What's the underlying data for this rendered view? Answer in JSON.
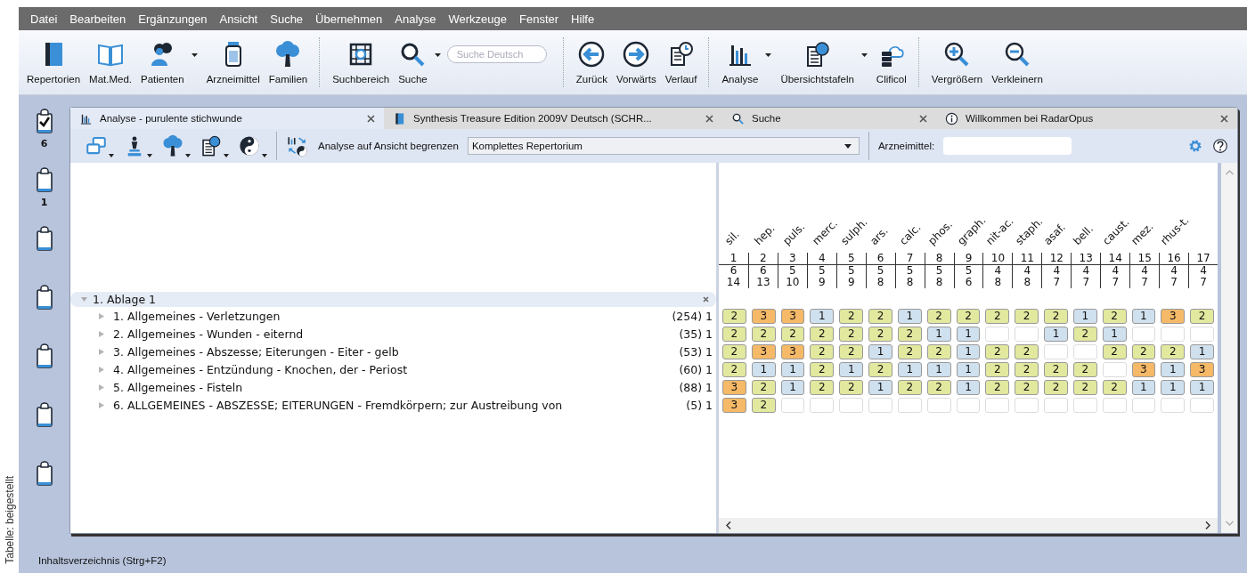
{
  "credit": "Tabelle: beigestellt",
  "menu": [
    "Datei",
    "Bearbeiten",
    "Ergänzungen",
    "Ansicht",
    "Suche",
    "Übernehmen",
    "Analyse",
    "Werkzeuge",
    "Fenster",
    "Hilfe"
  ],
  "toolbar": {
    "groups": [
      {
        "items": [
          {
            "label": "Repertorien",
            "kind": "book",
            "dropdown": false
          },
          {
            "label": "Mat.Med.",
            "kind": "openbook",
            "dropdown": false
          },
          {
            "label": "Patienten",
            "kind": "people",
            "dropdown": true
          },
          {
            "label": "Arzneimittel",
            "kind": "jar",
            "dropdown": false
          },
          {
            "label": "Familien",
            "kind": "tree",
            "dropdown": false
          }
        ]
      },
      {
        "items": [
          {
            "label": "Suchbereich",
            "kind": "target",
            "dropdown": false
          },
          {
            "label": "Suche",
            "kind": "search",
            "dropdown": true
          }
        ],
        "search": {
          "placeholder": "Suche Deutsch"
        }
      },
      {
        "items": [
          {
            "label": "Zurück",
            "kind": "back",
            "dropdown": false
          },
          {
            "label": "Vorwärts",
            "kind": "forward",
            "dropdown": false
          },
          {
            "label": "Verlauf",
            "kind": "history",
            "dropdown": false
          }
        ]
      },
      {
        "items": [
          {
            "label": "Analyse",
            "kind": "chart",
            "dropdown": true
          },
          {
            "label": "Übersichtstafeln",
            "kind": "tables",
            "dropdown": true
          },
          {
            "label": "Clificol",
            "kind": "cloud",
            "dropdown": false
          }
        ]
      },
      {
        "items": [
          {
            "label": "Vergrößern",
            "kind": "zoomin",
            "dropdown": false
          },
          {
            "label": "Verkleinern",
            "kind": "zoomout",
            "dropdown": false
          }
        ]
      }
    ]
  },
  "clipboards": [
    {
      "checked": true,
      "count": "6"
    },
    {
      "checked": false,
      "count": "1"
    },
    {
      "checked": false
    },
    {
      "checked": false
    },
    {
      "checked": false
    },
    {
      "checked": false
    },
    {
      "checked": false
    }
  ],
  "tabs": [
    {
      "label": "Analyse - purulente stichwunde",
      "kind": "chart",
      "selected": true
    },
    {
      "label": "Synthesis Treasure Edition 2009V Deutsch (SCHR...",
      "kind": "book",
      "selected": false
    },
    {
      "label": "Suche",
      "kind": "search",
      "selected": false
    },
    {
      "label": "Willkommen bei RadarOpus",
      "kind": "info",
      "selected": false
    }
  ],
  "analysis_toolbar": {
    "tools": [
      {
        "kind": "windows",
        "dropdown": true
      },
      {
        "kind": "chess",
        "dropdown": true
      },
      {
        "kind": "tree",
        "dropdown": true
      },
      {
        "kind": "tables",
        "dropdown": true
      },
      {
        "kind": "yinyang",
        "dropdown": true
      }
    ],
    "limit_label": "Analyse auf Ansicht begrenzen",
    "limit_value": "Komplettes Repertorium",
    "remedy_label": "Arzneimittel:"
  },
  "tree": {
    "label": "1. Ablage 1",
    "expanded": true,
    "children": [
      {
        "label": "1. Allgemeines - Verletzungen",
        "count": "(254) 1",
        "expanded": false
      },
      {
        "label": "2. Allgemeines - Wunden - eiternd",
        "count": "(35) 1",
        "expanded": false
      },
      {
        "label": "3. Allgemeines - Abszesse; Eiterungen - Eiter - gelb",
        "count": "(53) 1",
        "expanded": false
      },
      {
        "label": "4. Allgemeines - Entzündung - Knochen, der - Periost",
        "count": "(60) 1",
        "expanded": false
      },
      {
        "label": "5. Allgemeines - Fisteln",
        "count": "(88) 1",
        "expanded": false
      },
      {
        "label": "6. ALLGEMEINES - ABSZESSE; EITERUNGEN - Fremdkörpern; zur Austreibung von",
        "count": "(5) 1",
        "expanded": false
      }
    ]
  },
  "remedies": [
    {
      "name": "sil.",
      "number": "1",
      "count": "6",
      "total": "14"
    },
    {
      "name": "hep.",
      "number": "2",
      "count": "6",
      "total": "13"
    },
    {
      "name": "puls.",
      "number": "3",
      "count": "5",
      "total": "10"
    },
    {
      "name": "merc.",
      "number": "4",
      "count": "5",
      "total": "9"
    },
    {
      "name": "sulph.",
      "number": "5",
      "count": "5",
      "total": "9"
    },
    {
      "name": "ars.",
      "number": "6",
      "count": "5",
      "total": "8"
    },
    {
      "name": "calc.",
      "number": "7",
      "count": "5",
      "total": "8"
    },
    {
      "name": "phos.",
      "number": "8",
      "count": "5",
      "total": "8"
    },
    {
      "name": "graph.",
      "number": "9",
      "count": "5",
      "total": "6"
    },
    {
      "name": "nit-ac.",
      "number": "10",
      "count": "4",
      "total": "8"
    },
    {
      "name": "staph.",
      "number": "11",
      "count": "4",
      "total": "8"
    },
    {
      "name": "asaf.",
      "number": "12",
      "count": "4",
      "total": "7"
    },
    {
      "name": "bell.",
      "number": "13",
      "count": "4",
      "total": "7"
    },
    {
      "name": "caust.",
      "number": "14",
      "count": "4",
      "total": "7"
    },
    {
      "name": "mez.",
      "number": "15",
      "count": "4",
      "total": "7"
    },
    {
      "name": "rhus-t.",
      "number": "16",
      "count": "4",
      "total": "7"
    },
    {
      "number": "17",
      "count": "4",
      "total": "7"
    }
  ],
  "grid": [
    [
      {
        "kind": "grade",
        "value": "2",
        "color": "#e2e89e"
      },
      {
        "kind": "grade",
        "value": "3",
        "color": "#f5b968"
      },
      {
        "kind": "grade",
        "value": "3",
        "color": "#f5b968"
      },
      {
        "kind": "grade",
        "value": "1",
        "color": "#cfe0ee"
      },
      {
        "kind": "grade",
        "value": "2",
        "color": "#e2e89e"
      },
      {
        "kind": "grade",
        "value": "2",
        "color": "#e2e89e"
      },
      {
        "kind": "grade",
        "value": "1",
        "color": "#cfe0ee"
      },
      {
        "kind": "grade",
        "value": "2",
        "color": "#e2e89e"
      },
      {
        "kind": "grade",
        "value": "2",
        "color": "#e2e89e"
      },
      {
        "kind": "grade",
        "value": "2",
        "color": "#e2e89e"
      },
      {
        "kind": "grade",
        "value": "2",
        "color": "#e2e89e"
      },
      {
        "kind": "grade",
        "value": "2",
        "color": "#e2e89e"
      },
      {
        "kind": "grade",
        "value": "1",
        "color": "#cfe0ee"
      },
      {
        "kind": "grade",
        "value": "2",
        "color": "#e2e89e"
      },
      {
        "kind": "grade",
        "value": "1",
        "color": "#cfe0ee"
      },
      {
        "kind": "grade",
        "value": "3",
        "color": "#f5b968"
      },
      {
        "kind": "grade",
        "value": "2",
        "color": "#e2e89e"
      }
    ],
    [
      {
        "kind": "grade",
        "value": "2",
        "color": "#e2e89e"
      },
      {
        "kind": "grade",
        "value": "2",
        "color": "#e2e89e"
      },
      {
        "kind": "grade",
        "value": "2",
        "color": "#e2e89e"
      },
      {
        "kind": "grade",
        "value": "2",
        "color": "#e2e89e"
      },
      {
        "kind": "grade",
        "value": "2",
        "color": "#e2e89e"
      },
      {
        "kind": "grade",
        "value": "2",
        "color": "#e2e89e"
      },
      {
        "kind": "grade",
        "value": "2",
        "color": "#e2e89e"
      },
      {
        "kind": "grade",
        "value": "1",
        "color": "#cfe0ee"
      },
      {
        "kind": "grade",
        "value": "1",
        "color": "#cfe0ee"
      },
      {
        "kind": "empty"
      },
      {
        "kind": "empty"
      },
      {
        "kind": "grade",
        "value": "1",
        "color": "#cfe0ee"
      },
      {
        "kind": "grade",
        "value": "2",
        "color": "#e2e89e"
      },
      {
        "kind": "grade",
        "value": "1",
        "color": "#cfe0ee"
      },
      {
        "kind": "empty"
      },
      {
        "kind": "empty"
      },
      {
        "kind": "empty"
      }
    ],
    [
      {
        "kind": "grade",
        "value": "2",
        "color": "#e2e89e"
      },
      {
        "kind": "grade",
        "value": "3",
        "color": "#f5b968"
      },
      {
        "kind": "grade",
        "value": "3",
        "color": "#f5b968"
      },
      {
        "kind": "grade",
        "value": "2",
        "color": "#e2e89e"
      },
      {
        "kind": "grade",
        "value": "2",
        "color": "#e2e89e"
      },
      {
        "kind": "grade",
        "value": "1",
        "color": "#cfe0ee"
      },
      {
        "kind": "grade",
        "value": "2",
        "color": "#e2e89e"
      },
      {
        "kind": "grade",
        "value": "2",
        "color": "#e2e89e"
      },
      {
        "kind": "grade",
        "value": "1",
        "color": "#cfe0ee"
      },
      {
        "kind": "grade",
        "value": "2",
        "color": "#e2e89e"
      },
      {
        "kind": "grade",
        "value": "2",
        "color": "#e2e89e"
      },
      {
        "kind": "empty"
      },
      {
        "kind": "empty"
      },
      {
        "kind": "grade",
        "value": "2",
        "color": "#e2e89e"
      },
      {
        "kind": "grade",
        "value": "2",
        "color": "#e2e89e"
      },
      {
        "kind": "grade",
        "value": "2",
        "color": "#e2e89e"
      },
      {
        "kind": "grade",
        "value": "1",
        "color": "#cfe0ee"
      }
    ],
    [
      {
        "kind": "grade",
        "value": "2",
        "color": "#e2e89e"
      },
      {
        "kind": "grade",
        "value": "1",
        "color": "#cfe0ee"
      },
      {
        "kind": "grade",
        "value": "1",
        "color": "#cfe0ee"
      },
      {
        "kind": "grade",
        "value": "2",
        "color": "#e2e89e"
      },
      {
        "kind": "grade",
        "value": "1",
        "color": "#cfe0ee"
      },
      {
        "kind": "grade",
        "value": "2",
        "color": "#e2e89e"
      },
      {
        "kind": "grade",
        "value": "1",
        "color": "#cfe0ee"
      },
      {
        "kind": "grade",
        "value": "1",
        "color": "#cfe0ee"
      },
      {
        "kind": "grade",
        "value": "1",
        "color": "#cfe0ee"
      },
      {
        "kind": "grade",
        "value": "2",
        "color": "#e2e89e"
      },
      {
        "kind": "grade",
        "value": "2",
        "color": "#e2e89e"
      },
      {
        "kind": "grade",
        "value": "2",
        "color": "#e2e89e"
      },
      {
        "kind": "grade",
        "value": "2",
        "color": "#e2e89e"
      },
      {
        "kind": "empty"
      },
      {
        "kind": "grade",
        "value": "3",
        "color": "#f5b968"
      },
      {
        "kind": "grade",
        "value": "1",
        "color": "#cfe0ee"
      },
      {
        "kind": "grade",
        "value": "3",
        "color": "#f5b968"
      }
    ],
    [
      {
        "kind": "grade",
        "value": "3",
        "color": "#f5b968"
      },
      {
        "kind": "grade",
        "value": "2",
        "color": "#e2e89e"
      },
      {
        "kind": "grade",
        "value": "1",
        "color": "#cfe0ee"
      },
      {
        "kind": "grade",
        "value": "2",
        "color": "#e2e89e"
      },
      {
        "kind": "grade",
        "value": "2",
        "color": "#e2e89e"
      },
      {
        "kind": "grade",
        "value": "1",
        "color": "#cfe0ee"
      },
      {
        "kind": "grade",
        "value": "2",
        "color": "#e2e89e"
      },
      {
        "kind": "grade",
        "value": "2",
        "color": "#e2e89e"
      },
      {
        "kind": "grade",
        "value": "1",
        "color": "#cfe0ee"
      },
      {
        "kind": "grade",
        "value": "2",
        "color": "#e2e89e"
      },
      {
        "kind": "grade",
        "value": "2",
        "color": "#e2e89e"
      },
      {
        "kind": "grade",
        "value": "2",
        "color": "#e2e89e"
      },
      {
        "kind": "grade",
        "value": "2",
        "color": "#e2e89e"
      },
      {
        "kind": "grade",
        "value": "2",
        "color": "#e2e89e"
      },
      {
        "kind": "grade",
        "value": "1",
        "color": "#cfe0ee"
      },
      {
        "kind": "grade",
        "value": "1",
        "color": "#cfe0ee"
      },
      {
        "kind": "grade",
        "value": "1",
        "color": "#cfe0ee"
      }
    ],
    [
      {
        "kind": "grade",
        "value": "3",
        "color": "#f5b968"
      },
      {
        "kind": "grade",
        "value": "2",
        "color": "#e2e89e"
      },
      {
        "kind": "empty"
      },
      {
        "kind": "empty"
      },
      {
        "kind": "empty"
      },
      {
        "kind": "empty"
      },
      {
        "kind": "empty"
      },
      {
        "kind": "empty"
      },
      {
        "kind": "empty"
      },
      {
        "kind": "empty"
      },
      {
        "kind": "empty"
      },
      {
        "kind": "empty"
      },
      {
        "kind": "empty"
      },
      {
        "kind": "empty"
      },
      {
        "kind": "empty"
      },
      {
        "kind": "empty"
      },
      {
        "kind": "empty"
      }
    ]
  ],
  "status_bar": "Inhaltsverzeichnis (Strg+F2)"
}
